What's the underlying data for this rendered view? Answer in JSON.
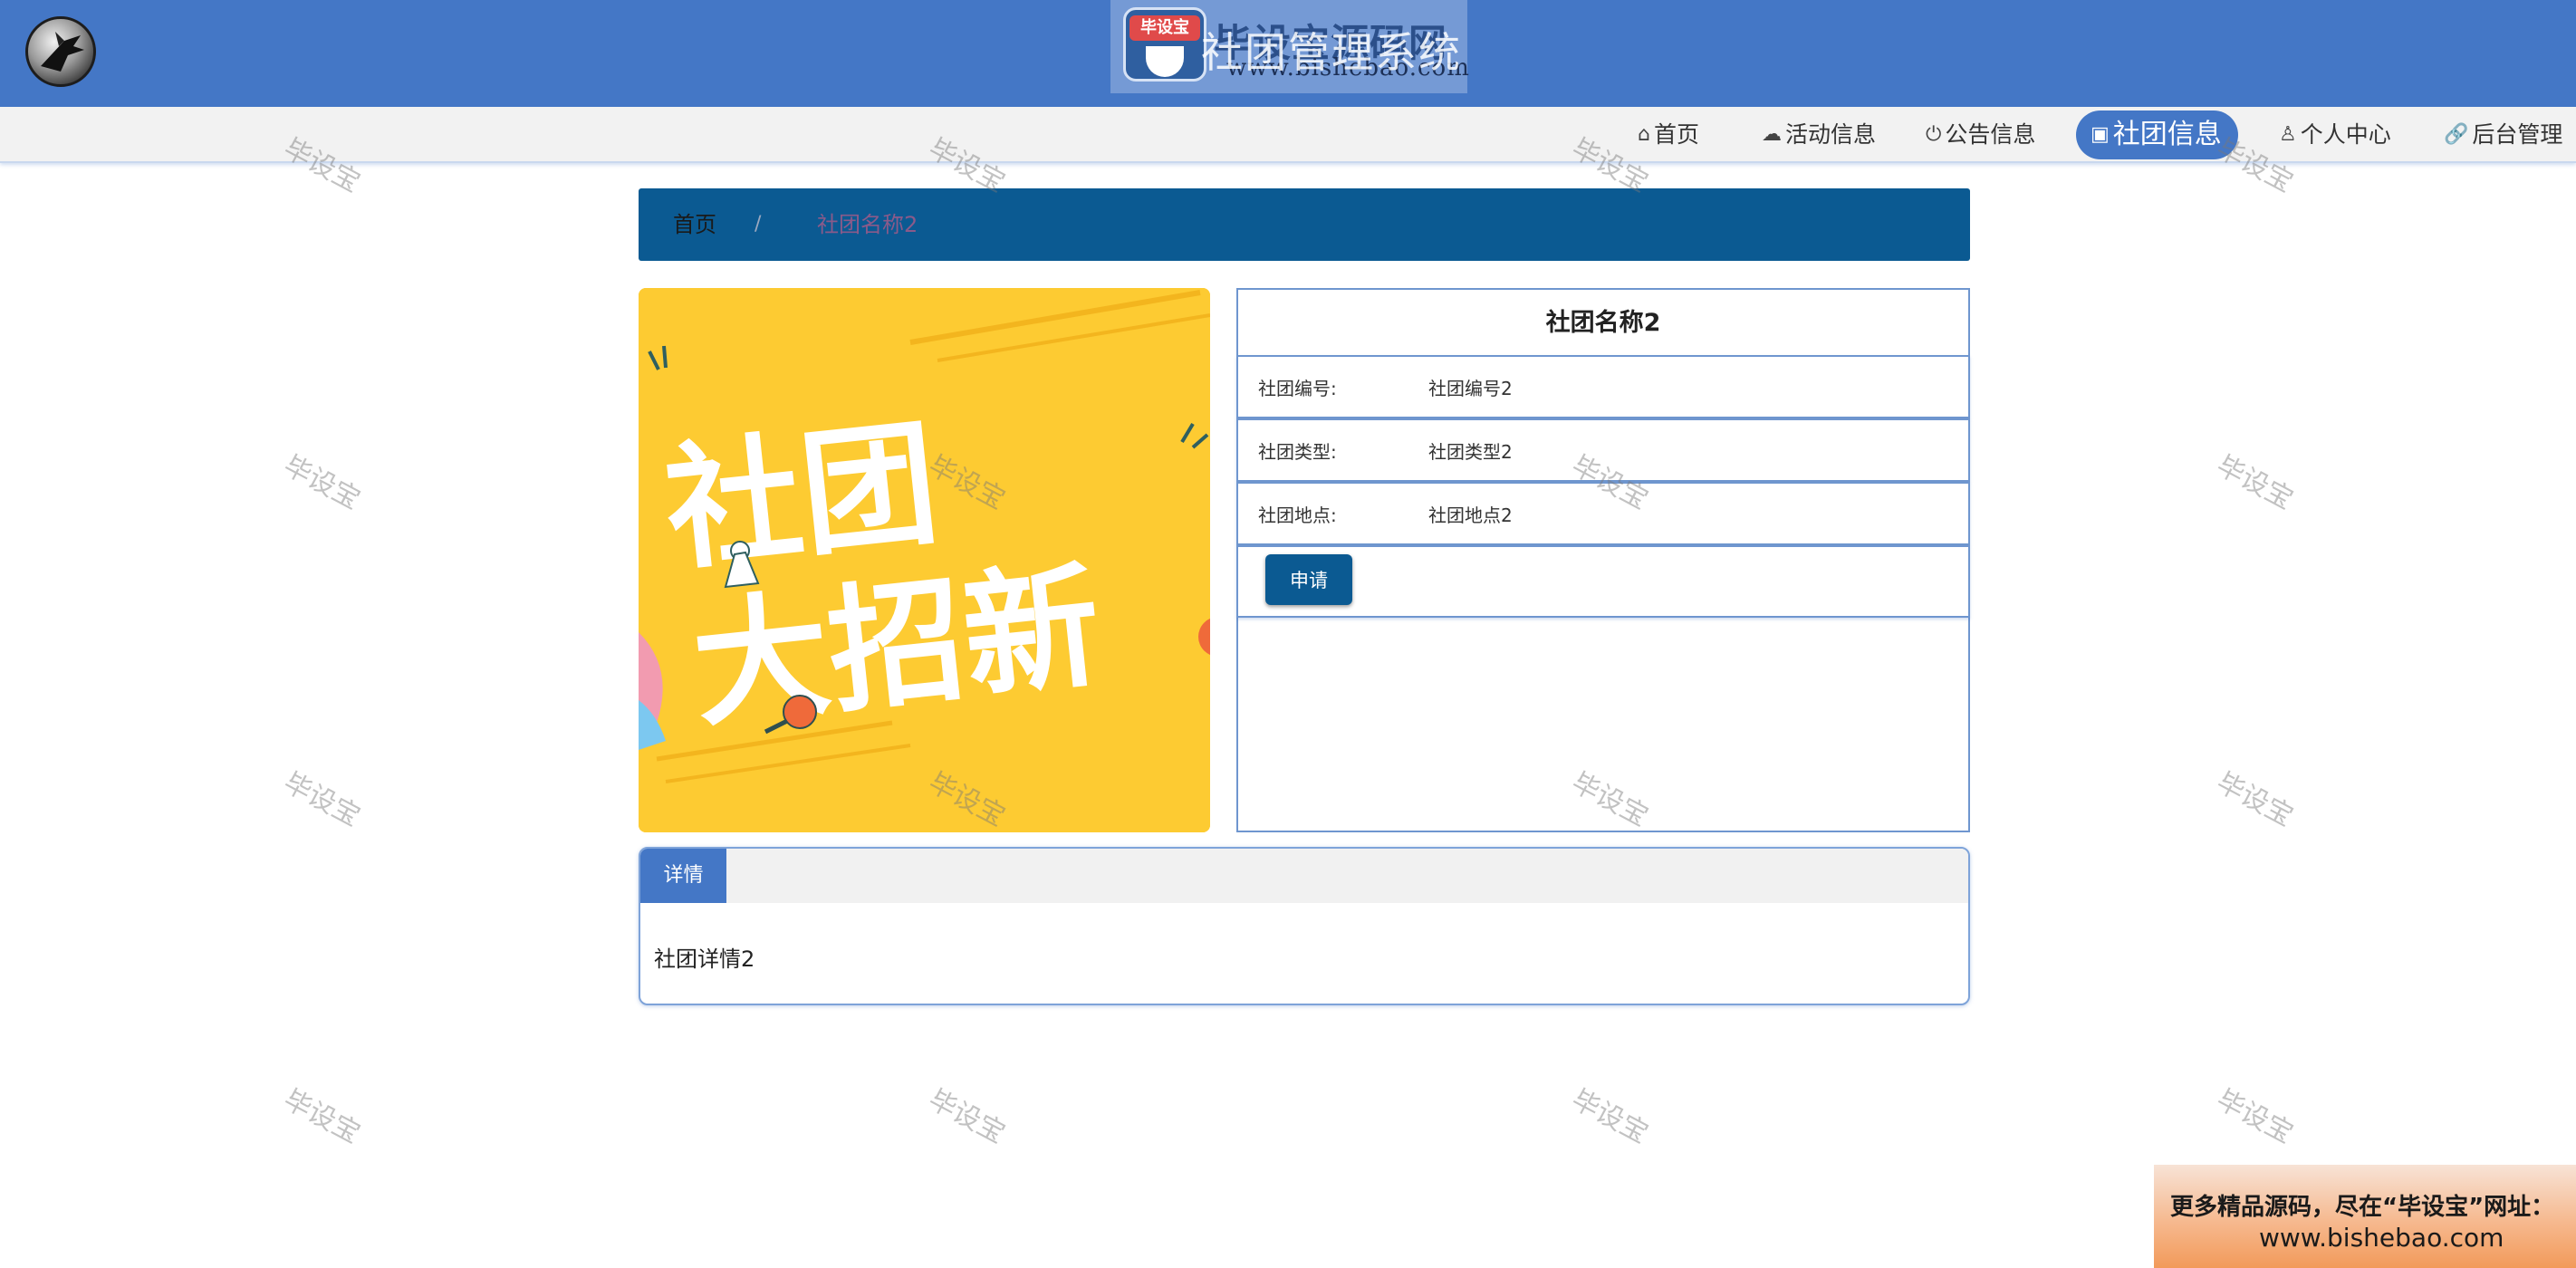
{
  "header": {
    "site_title": "社团管理系统",
    "logo_name": "毕设宝源码网",
    "logo_url": "www.bishebao.com",
    "logo_badge": "毕设宝"
  },
  "nav": {
    "items": [
      {
        "label": "首页",
        "icon": "home-icon"
      },
      {
        "label": "活动信息",
        "icon": "cloud-icon"
      },
      {
        "label": "公告信息",
        "icon": "power-icon"
      },
      {
        "label": "社团信息",
        "icon": "clipboard-icon",
        "active": true
      },
      {
        "label": "个人中心",
        "icon": "user-icon"
      },
      {
        "label": "后台管理",
        "icon": "link-icon"
      }
    ]
  },
  "breadcrumb": {
    "home": "首页",
    "separator": "/",
    "current": "社团名称2"
  },
  "banner": {
    "line1": "社团",
    "line2": "大招新"
  },
  "info": {
    "title": "社团名称2",
    "rows": [
      {
        "label": "社团编号:",
        "value": "社团编号2"
      },
      {
        "label": "社团类型:",
        "value": "社团类型2"
      },
      {
        "label": "社团地点:",
        "value": "社团地点2"
      }
    ],
    "apply_label": "申请"
  },
  "detail": {
    "tab_label": "详情",
    "content": "社团详情2"
  },
  "watermark": "毕设宝",
  "ad": {
    "line1": "更多精品源码，尽在“毕设宝”网址：",
    "line2": "www.bishebao.com"
  },
  "colors": {
    "header_bg": "#4477c6",
    "nav_active": "#4477c6",
    "breadcrumb_bg": "#0b5a92",
    "button_bg": "#0b5a92",
    "panel_border": "#6f96cf",
    "banner_bg": "#fdcb32"
  }
}
